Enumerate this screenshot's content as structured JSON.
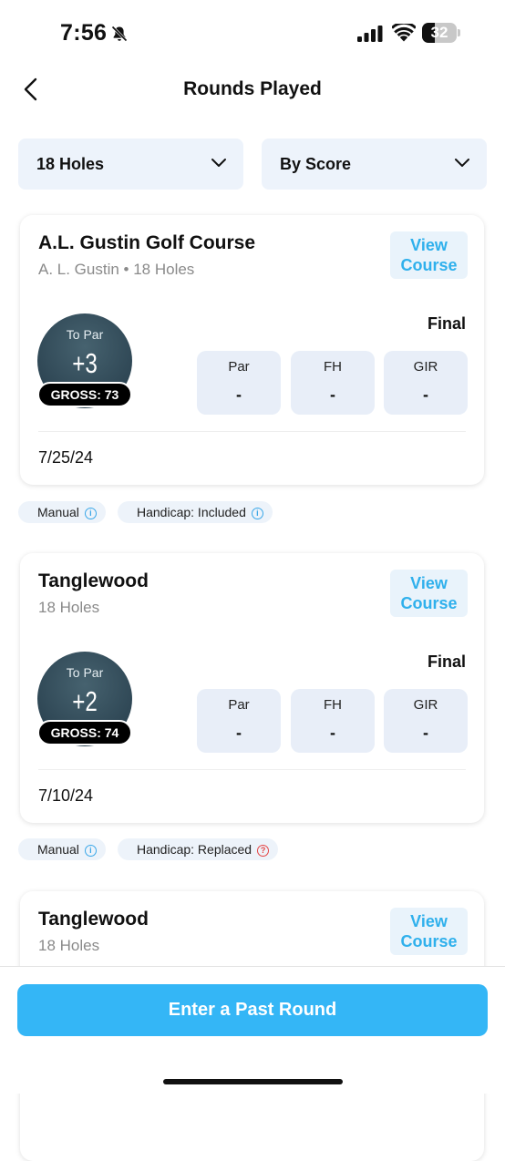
{
  "status_bar": {
    "time": "7:56",
    "battery": "32",
    "icons": [
      "bell-slash-icon",
      "cellular-signal-icon",
      "wifi-icon",
      "battery-icon"
    ]
  },
  "header": {
    "title": "Rounds Played",
    "back_icon": "chevron-left-icon"
  },
  "filters": [
    {
      "label": "18 Holes",
      "icon": "chevron-down-icon"
    },
    {
      "label": "By Score",
      "icon": "chevron-down-icon"
    }
  ],
  "rounds": [
    {
      "course": "A.L. Gustin Golf Course",
      "subtitle": "A. L. Gustin • 18 Holes",
      "view_label_1": "View",
      "view_label_2": "Course",
      "to_par_label": "To Par",
      "to_par": "+3",
      "gross": "GROSS: 73",
      "status": "Final",
      "stats": [
        {
          "label": "Par",
          "value": "-"
        },
        {
          "label": "FH",
          "value": "-"
        },
        {
          "label": "GIR",
          "value": "-"
        }
      ],
      "date": "7/25/24",
      "tags": [
        {
          "label": "Manual",
          "icon": "info-icon"
        },
        {
          "label": "Handicap: Included",
          "icon": "info-icon"
        }
      ]
    },
    {
      "course": "Tanglewood",
      "subtitle": "18 Holes",
      "view_label_1": "View",
      "view_label_2": "Course",
      "to_par_label": "To Par",
      "to_par": "+2",
      "gross": "GROSS: 74",
      "status": "Final",
      "stats": [
        {
          "label": "Par",
          "value": "-"
        },
        {
          "label": "FH",
          "value": "-"
        },
        {
          "label": "GIR",
          "value": "-"
        }
      ],
      "date": "7/10/24",
      "tags": [
        {
          "label": "Manual",
          "icon": "info-icon"
        },
        {
          "label": "Handicap: Replaced",
          "icon": "question-icon"
        }
      ]
    },
    {
      "course": "Tanglewood",
      "subtitle": "18 Holes",
      "view_label_1": "View",
      "view_label_2": "Course"
    }
  ],
  "cta": {
    "label": "Enter a Past Round"
  },
  "colors": {
    "accent": "#34b6f6",
    "link": "#2fb0ec",
    "card_fill": "#e8eef8",
    "warning": "#e44545"
  }
}
